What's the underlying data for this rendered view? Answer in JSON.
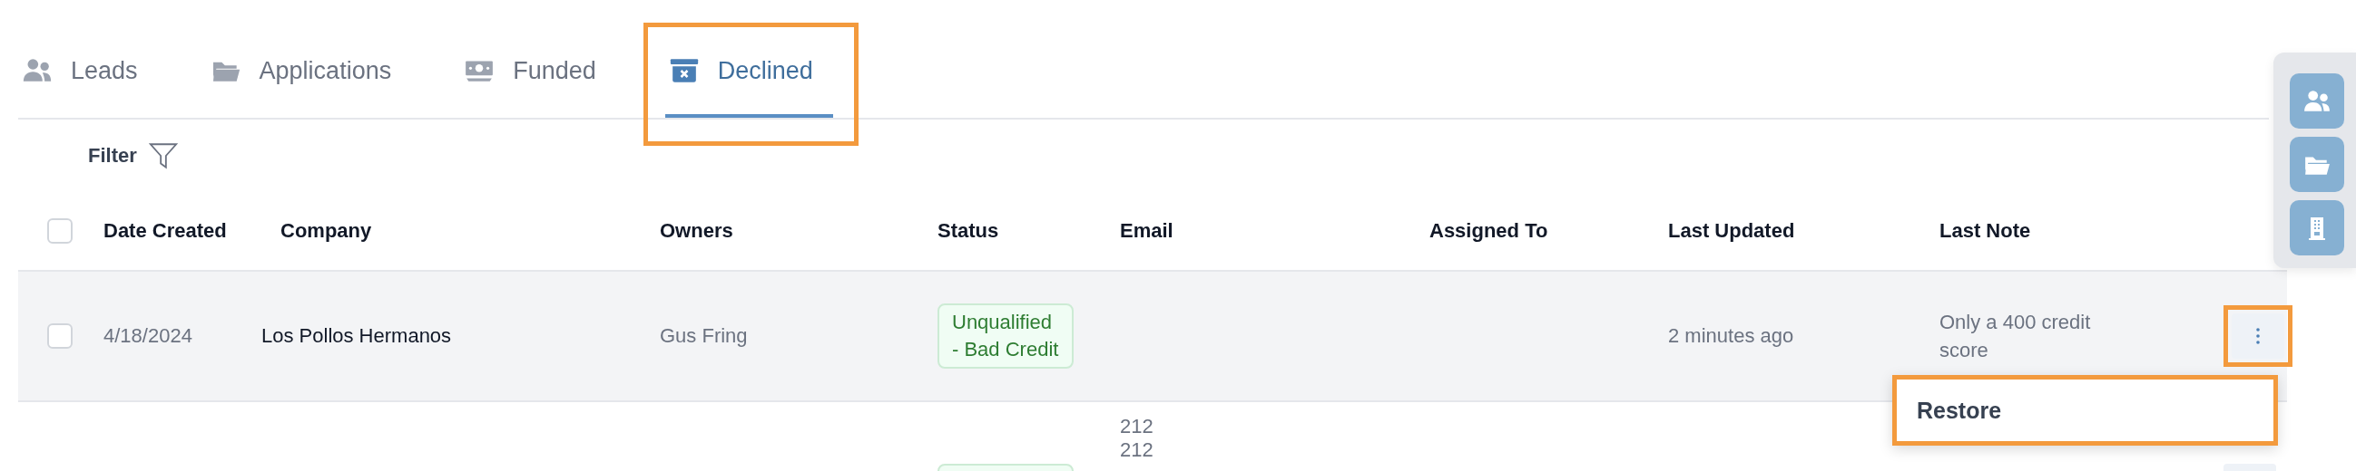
{
  "tabs": [
    {
      "label": "Leads",
      "kind": "people",
      "selected": false,
      "highlighted": false
    },
    {
      "label": "Applications",
      "kind": "folder",
      "selected": false,
      "highlighted": false
    },
    {
      "label": "Funded",
      "kind": "money",
      "selected": false,
      "highlighted": false
    },
    {
      "label": "Declined",
      "kind": "archive",
      "selected": true,
      "highlighted": true
    }
  ],
  "filter": {
    "label": "Filter"
  },
  "table": {
    "header_checkbox": {
      "checked": false
    },
    "columns": [
      "Date Created",
      "Company",
      "Owners",
      "Status",
      "Email",
      "Assigned To",
      "Last Updated",
      "Last Note"
    ],
    "rows": [
      {
        "active": true,
        "checkbox": {
          "checked": false
        },
        "date_created": "4/18/2024",
        "company": "Los Pollos Hermanos",
        "owners": "Gus Fring",
        "status": {
          "kind": "text",
          "label": "Unqualified - Bad Credit"
        },
        "last_updated": "2 minutes ago",
        "last_note": "Only a 400 credit score",
        "menu_button": true,
        "menu_button_highlighted": true
      },
      {
        "active": false,
        "email": "212 212",
        "status": {
          "kind": "cut"
        },
        "menu_button": true
      }
    ]
  },
  "row_menu": {
    "items": [
      "Restore"
    ],
    "highlighted": true
  },
  "dock": [
    {
      "kind": "people"
    },
    {
      "kind": "folder"
    },
    {
      "kind": "building"
    }
  ]
}
